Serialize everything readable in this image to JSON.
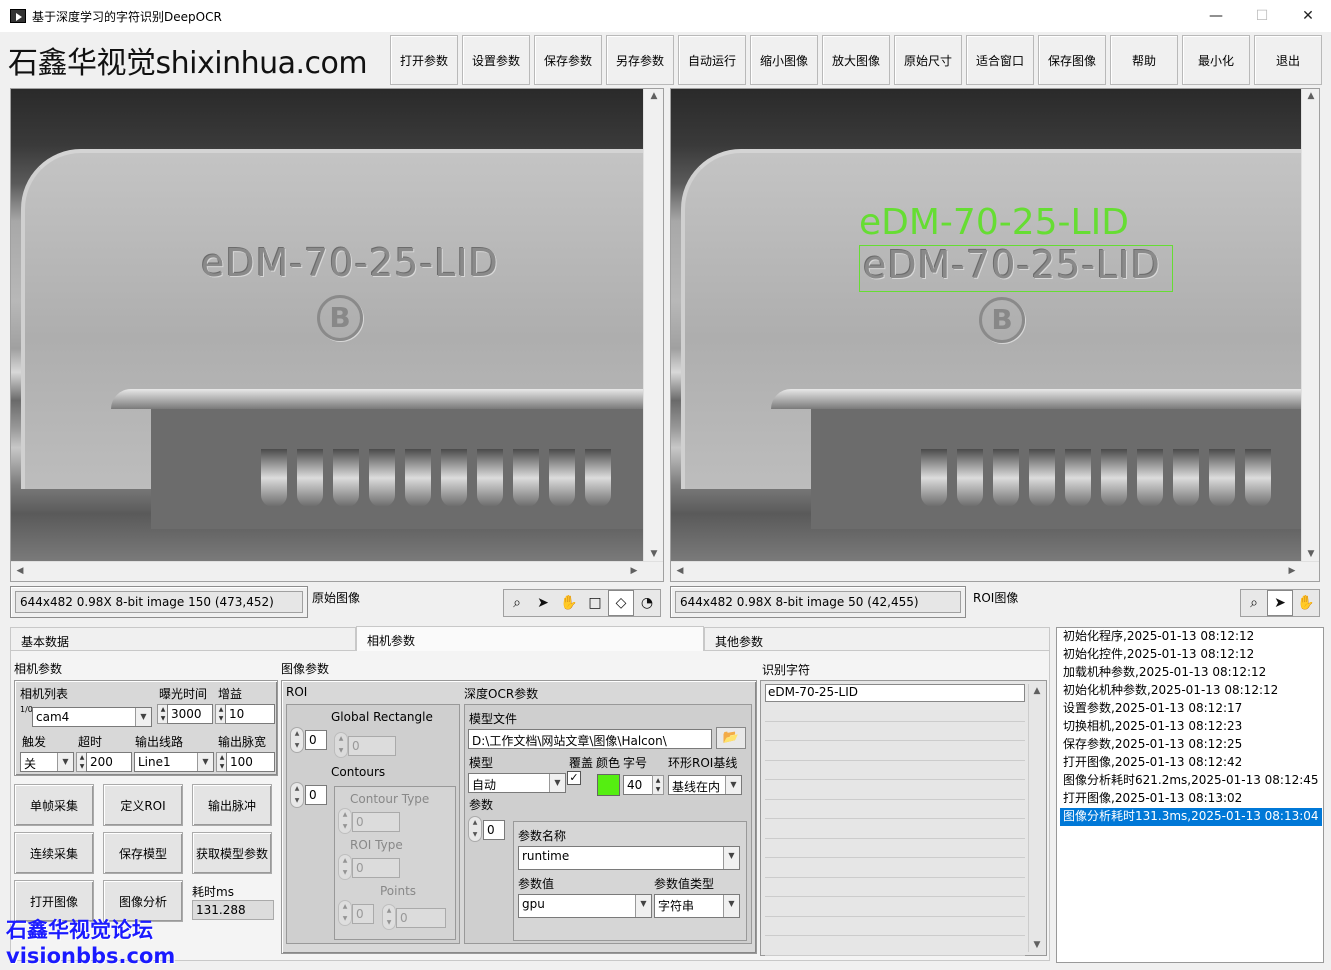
{
  "window": {
    "title": "基于深度学习的字符识别DeepOCR",
    "min": "—",
    "max": "☐",
    "close": "✕"
  },
  "brand": "石鑫华视觉shixinhua.com",
  "toolbar": [
    "打开参数",
    "设置参数",
    "保存参数",
    "另存参数",
    "自动运行",
    "缩小图像",
    "放大图像",
    "原始尺寸",
    "适合窗口",
    "保存图像",
    "帮助",
    "最小化",
    "退出"
  ],
  "left_view": {
    "status": "644x482 0.98X 8-bit image 150    (473,452)",
    "label": "原始图像",
    "engraved": "eDM-70-25-LID",
    "logo": "B"
  },
  "right_view": {
    "status": "644x482 0.98X 8-bit image 50      (42,455)",
    "label": "ROI图像",
    "engraved": "eDM-70-25-LID",
    "logo": "B",
    "result_overlay": "eDM-70-25-LID",
    "overlay_color": "#66dd33"
  },
  "tabs": [
    "基本数据",
    "相机参数",
    "其他参数"
  ],
  "active_tab": "相机参数",
  "camera": {
    "section": "相机参数",
    "list_label": "相机列表",
    "list_value": "cam4",
    "list_index": "1/0",
    "exposure_label": "曝光时间",
    "exposure": "3000",
    "gain_label": "增益",
    "gain": "10",
    "trigger_label": "触发",
    "trigger": "关",
    "timeout_label": "超时",
    "timeout": "200",
    "line_label": "输出线路",
    "line": "Line1",
    "pulse_label": "输出脉宽",
    "pulse": "100",
    "buttons": [
      "单帧采集",
      "定义ROI",
      "输出脉冲",
      "连续采集",
      "保存模型",
      "获取模型参数",
      "打开图像",
      "图像分析"
    ],
    "elapsed_label": "耗时ms",
    "elapsed": "131.288"
  },
  "image_params": {
    "section": "图像参数",
    "roi_label": "ROI",
    "global_rect_label": "Global Rectangle",
    "roi_index": "0",
    "rect_index": "0",
    "contours_label": "Contours",
    "contours_index": "0",
    "contour_type_label": "Contour Type",
    "contour_type": "0",
    "roi_type_label": "ROI Type",
    "roi_type": "0",
    "points_label": "Points",
    "points_a": "0",
    "points_b": "0",
    "ocr_label": "深度OCR参数",
    "model_file_label": "模型文件",
    "model_file": "D:\\工作文档\\网站文章\\图像\\Halcon\\",
    "model_label": "模型",
    "model": "自动",
    "overlay_label": "覆盖",
    "color_label": "颜色",
    "font_label": "字号",
    "font_size": "40",
    "ring_label": "环形ROI基线",
    "ring": "基线在内",
    "swatch_color": "#55ee11",
    "param_label": "参数",
    "param_index": "0",
    "param_name_label": "参数名称",
    "param_name": "runtime",
    "param_value_label": "参数值",
    "param_value": "gpu",
    "param_type_label": "参数值类型",
    "param_type": "字符串"
  },
  "recognized": {
    "label": "识别字符",
    "rows": [
      "eDM-70-25-LID",
      "",
      "",
      "",
      "",
      "",
      "",
      "",
      "",
      "",
      "",
      "",
      "",
      ""
    ]
  },
  "log": [
    "初始化程序,2025-01-13 08:12:12",
    "初始化控件,2025-01-13 08:12:12",
    "加载机种参数,2025-01-13 08:12:12",
    "初始化机种参数,2025-01-13 08:12:12",
    "设置参数,2025-01-13 08:12:17",
    "切换相机,2025-01-13 08:12:23",
    "保存参数,2025-01-13 08:12:25",
    "打开图像,2025-01-13 08:12:42",
    "图像分析耗时621.2ms,2025-01-13 08:12:45",
    "打开图像,2025-01-13 08:13:02",
    "图像分析耗时131.3ms,2025-01-13 08:13:04"
  ],
  "watermark": {
    "line1": "石鑫华视觉论坛",
    "line2": "visionbbs.com"
  }
}
